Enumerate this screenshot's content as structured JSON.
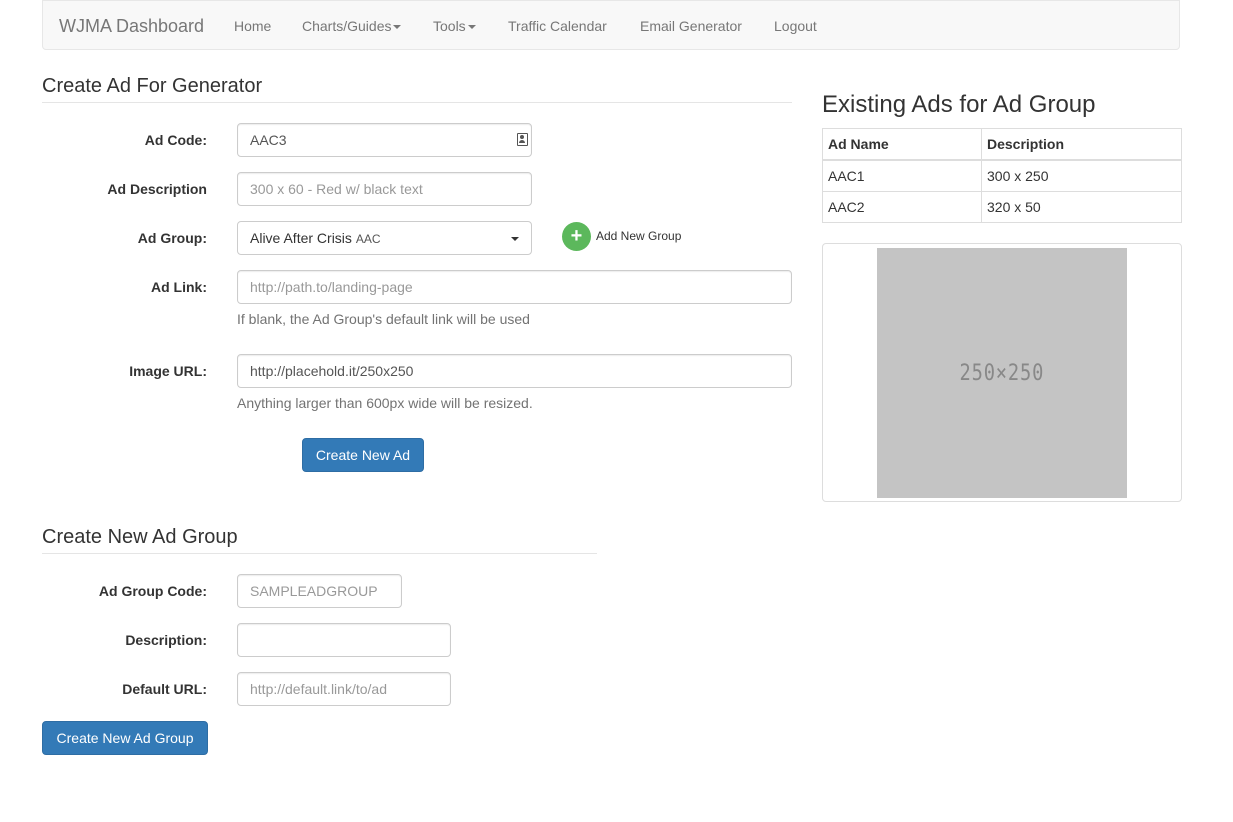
{
  "navbar": {
    "brand": "WJMA Dashboard",
    "items": [
      {
        "label": "Home"
      },
      {
        "label": "Charts/Guides"
      },
      {
        "label": "Tools"
      },
      {
        "label": "Traffic Calendar"
      },
      {
        "label": "Email Generator"
      },
      {
        "label": "Logout"
      }
    ]
  },
  "create_ad": {
    "title": "Create Ad For Generator",
    "ad_code": {
      "label": "Ad Code:",
      "value": "AAC3"
    },
    "ad_description": {
      "label": "Ad Description",
      "placeholder": "300 x 60 - Red w/ black text"
    },
    "ad_group": {
      "label": "Ad Group:",
      "selected_name": "Alive After Crisis",
      "selected_code": "AAC"
    },
    "add_new_group": "Add New Group",
    "ad_link": {
      "label": "Ad Link:",
      "placeholder": "http://path.to/landing-page",
      "help": "If blank, the Ad Group's default link will be used"
    },
    "image_url": {
      "label": "Image URL:",
      "value": "http://placehold.it/250x250",
      "help": "Anything larger than 600px wide will be resized."
    },
    "submit_label": "Create New Ad"
  },
  "create_group": {
    "title": "Create New Ad Group",
    "group_code": {
      "label": "Ad Group Code:",
      "placeholder": "SAMPLEADGROUP"
    },
    "description": {
      "label": "Description:",
      "value": ""
    },
    "default_url": {
      "label": "Default URL:",
      "placeholder": "http://default.link/to/ad"
    },
    "submit_label": "Create New Ad Group"
  },
  "existing_ads": {
    "title": "Existing Ads for Ad Group",
    "columns": [
      "Ad Name",
      "Description"
    ],
    "rows": [
      [
        "AAC1",
        "300 x 250"
      ],
      [
        "AAC2",
        "320 x 50"
      ]
    ],
    "preview_text": "250×250"
  },
  "colors": {
    "primary": "#337ab7",
    "success": "#5cb85c",
    "placeholder_bg": "#c4c4c4"
  }
}
